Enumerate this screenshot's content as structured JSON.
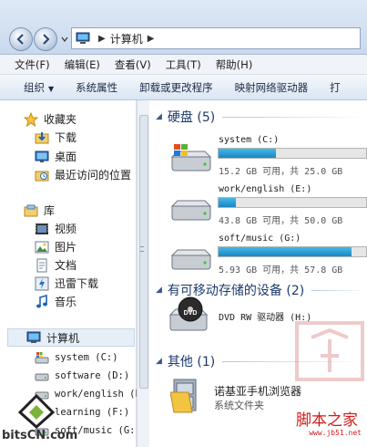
{
  "address": {
    "crumbs": [
      "计算机"
    ]
  },
  "menu": [
    "文件(F)",
    "编辑(E)",
    "查看(V)",
    "工具(T)",
    "帮助(H)"
  ],
  "commands": {
    "organize": "组织",
    "items": [
      "系统属性",
      "卸载或更改程序",
      "映射网络驱动器",
      "打"
    ]
  },
  "nav": {
    "favorites": "收藏夹",
    "fav_items": [
      "下载",
      "桌面",
      "最近访问的位置"
    ],
    "libraries": "库",
    "lib_items": [
      "视频",
      "图片",
      "文档",
      "迅雷下载",
      "音乐"
    ],
    "computer": "计算机",
    "drives": [
      "system (C:)",
      "software (D:)",
      "work/english (E",
      "learning (F:)",
      "soft/music (G:)"
    ]
  },
  "groups": {
    "hard_disks": "硬盘 (5)",
    "removable": "有可移动存储的设备 (2)",
    "other": "其他 (1)"
  },
  "drives": [
    {
      "name": "system  (C:)",
      "free_text": "15.2 GB 可用，共 25.0 GB",
      "used_fraction": 0.39
    },
    {
      "name": "work/english  (E:)",
      "free_text": "43.8 GB 可用，共 50.0 GB",
      "used_fraction": 0.12
    },
    {
      "name": "soft/music  (G:)",
      "free_text": "5.93 GB 可用，共 57.8 GB",
      "used_fraction": 0.9
    }
  ],
  "dvd": {
    "name": "DVD RW 驱动器 (H:)",
    "label": "DVD"
  },
  "other_item": {
    "name": "诺基亚手机浏览器",
    "sub": "系统文件夹"
  },
  "watermark": {
    "left": "bitsCN.com",
    "right_title": "脚本之家",
    "right_url": "www.jb51.net"
  },
  "colors": {
    "bar_fill": "#1a86c4",
    "group_title": "#1e3a6e",
    "watermark_red": "#d01a1a"
  }
}
